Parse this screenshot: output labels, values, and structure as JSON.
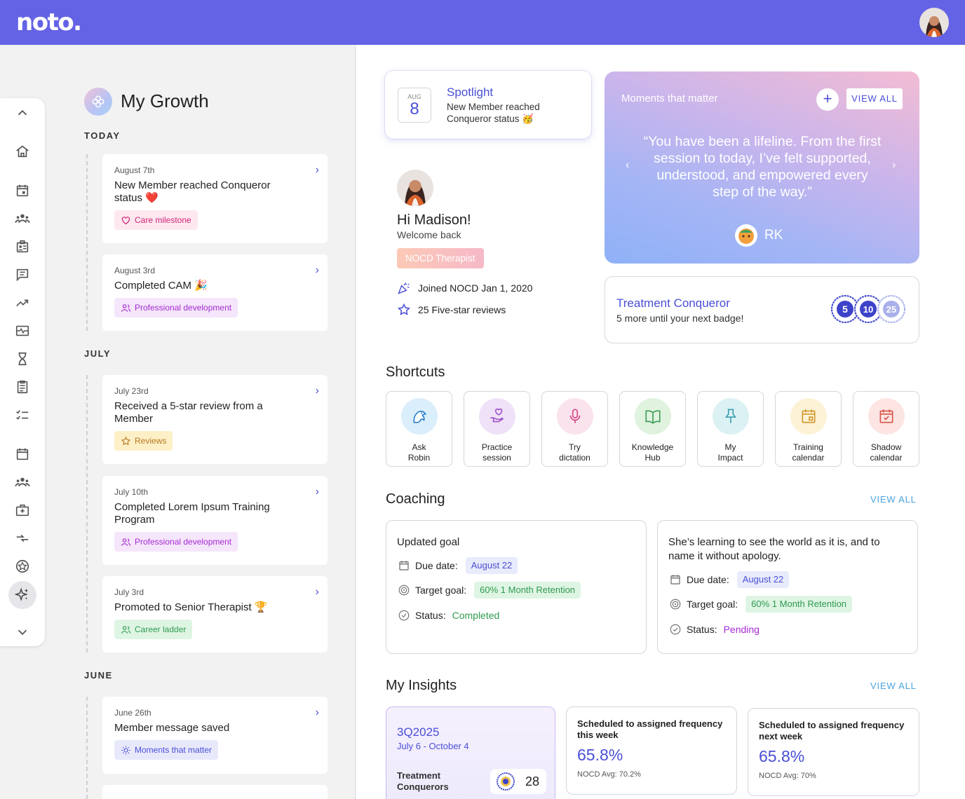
{
  "app": {
    "logo": "noto."
  },
  "page": {
    "title": "My Growth"
  },
  "sections": {
    "today": "TODAY",
    "july": "JULY",
    "june": "JUNE"
  },
  "timeline": [
    {
      "date": "August 7th",
      "text": "New Member reached Conqueror status ❤️",
      "tag": "Care milestone"
    },
    {
      "date": "August 3rd",
      "text": "Completed CAM 🎉",
      "tag": "Professional development"
    },
    {
      "date": "July 23rd",
      "text": "Received a 5-star review from a Member",
      "tag": "Reviews"
    },
    {
      "date": "July 10th",
      "text": "Completed Lorem Ipsum Training Program",
      "tag": "Professional development"
    },
    {
      "date": "July 3rd",
      "text": "Promoted to Senior Therapist 🏆",
      "tag": "Career ladder"
    },
    {
      "date": "June 26th",
      "text": "Member message saved",
      "tag": "Moments that matter"
    }
  ],
  "spotlight": {
    "month": "AUG",
    "day": "8",
    "title": "Spotlight",
    "text": "New Member reached Conqueror status 🥳"
  },
  "profile": {
    "greeting": "Hi Madison!",
    "welcome": "Welcome back",
    "role": "NOCD Therapist",
    "joined": "Joined NOCD Jan 1, 2020",
    "reviews": "25 Five-star reviews"
  },
  "moments": {
    "title": "Moments that matter",
    "view_all": "VIEW ALL",
    "quote": "“You have been a lifeline. From the first session to today, I’ve felt supported, understood, and empowered every step of the way.”",
    "author": "RK"
  },
  "conqueror": {
    "title": "Treatment Conqueror",
    "subtitle": "5 more until your next badge!",
    "badges": [
      "5",
      "10",
      "25"
    ]
  },
  "shortcuts": {
    "title": "Shortcuts",
    "items": [
      {
        "line1": "Ask",
        "line2": "Robin",
        "icon": "robin-icon",
        "bg": "#dbeefb"
      },
      {
        "line1": "Practice",
        "line2": "session",
        "icon": "hand-heart-icon",
        "bg": "#efe2f8"
      },
      {
        "line1": "Try",
        "line2": "dictation",
        "icon": "microphone-icon",
        "bg": "#fbe3ee"
      },
      {
        "line1": "Knowledge",
        "line2": "Hub",
        "icon": "book-icon",
        "bg": "#dff3df"
      },
      {
        "line1": "My",
        "line2": "Impact",
        "icon": "pin-icon",
        "bg": "#dcf1f4"
      },
      {
        "line1": "Training",
        "line2": "calendar",
        "icon": "calendar-icon",
        "bg": "#fcf2d6"
      },
      {
        "line1": "Shadow",
        "line2": "calendar",
        "icon": "calendar-check-icon",
        "bg": "#fde5e3"
      }
    ]
  },
  "coaching": {
    "title": "Coaching",
    "view_all": "VIEW ALL",
    "due_label": "Due date:",
    "target_label": "Target goal:",
    "status_label": "Status:",
    "cards": [
      {
        "title": "Updated goal",
        "due": "August 22",
        "target": "60% 1 Month Retention",
        "status": "Completed"
      },
      {
        "title": "She’s learning to see the world as it is, and to name it without apology.",
        "due": "August 22",
        "target": "60% 1 Month Retention",
        "status": "Pending"
      }
    ]
  },
  "insights": {
    "title": "My Insights",
    "view_all": "VIEW ALL",
    "quarter": "3Q2025",
    "range": "July 6 - October 4",
    "treatment_label": "Treatment Conquerors",
    "treatment_count": "28",
    "cards": [
      {
        "heading": "Scheduled to assigned frequency this week",
        "value": "65.8%",
        "avg": "NOCD Avg: 70.2%"
      },
      {
        "heading": "Scheduled to assigned frequency next week",
        "value": "65.8%",
        "avg": "NOCD Avg: 70%"
      }
    ]
  },
  "colors": {
    "brand": "#6463e6",
    "accent": "#4a4fd6",
    "link": "#4ba3dd"
  }
}
